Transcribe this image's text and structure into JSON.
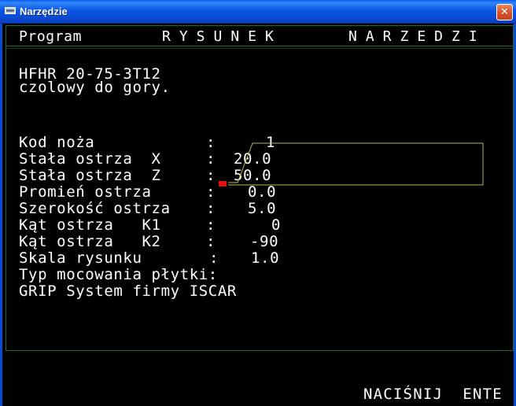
{
  "window": {
    "title": "Narzędzie",
    "close_glyph": "✕"
  },
  "header": {
    "left": "Program",
    "mid": "RYSUNEK",
    "right": "NARZEDZI"
  },
  "tool": {
    "code": "HFHR 20-75-3T12",
    "description": "czolowy do gory."
  },
  "params": [
    {
      "label": "Kod noża",
      "sep": ":",
      "value": "1"
    },
    {
      "label": "Stała ostrza  X",
      "sep": ":",
      "value": "20.0"
    },
    {
      "label": "Stała ostrza  Z",
      "sep": ":",
      "value": "50.0"
    },
    {
      "label": "Promień ostrza",
      "sep": ":",
      "value": "0.0"
    },
    {
      "label": "Szerokość ostrza",
      "sep": ":",
      "value": "5.0"
    },
    {
      "label": "Kąt ostrza   K1",
      "sep": ":",
      "value": "0"
    },
    {
      "label": "Kąt ostrza   K2",
      "sep": ":",
      "value": "-90"
    },
    {
      "label": "Skala rysunku",
      "sep": ":",
      "value": "1.0"
    }
  ],
  "mounting": {
    "label": "Typ mocowania płytki:",
    "value": "GRIP System firmy ISCAR"
  },
  "footer": {
    "prompt": "NACIŚNIJ  ENTE"
  },
  "colors": {
    "text": "#ffffff",
    "frame": "#1d6e23",
    "tool_outline": "#bdb64a",
    "tool_tip": "#e01010"
  }
}
